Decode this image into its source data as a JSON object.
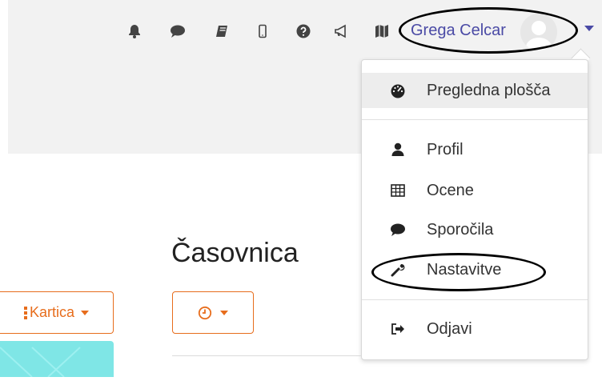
{
  "topbar": {
    "icons": [
      {
        "name": "bell-icon"
      },
      {
        "name": "comment-icon"
      },
      {
        "name": "book-icon"
      },
      {
        "name": "mobile-icon"
      },
      {
        "name": "question-icon"
      },
      {
        "name": "bullhorn-icon"
      },
      {
        "name": "map-icon"
      }
    ],
    "user_name": "Grega Celcar",
    "accent_color": "#4a4aa5"
  },
  "user_menu": {
    "items": [
      {
        "label": "Pregledna plošča",
        "icon": "tachometer-icon"
      },
      {
        "label": "Profil",
        "icon": "user-icon"
      },
      {
        "label": "Ocene",
        "icon": "table-icon"
      },
      {
        "label": "Sporočila",
        "icon": "comment-icon"
      },
      {
        "label": "Nastavitve",
        "icon": "wrench-icon"
      },
      {
        "label": "Odjavi",
        "icon": "sign-out-icon"
      }
    ]
  },
  "main": {
    "title": "Časovnica",
    "view_button_label": "Kartica",
    "clock_button": "clock-icon",
    "button_color": "#e76d1c"
  }
}
